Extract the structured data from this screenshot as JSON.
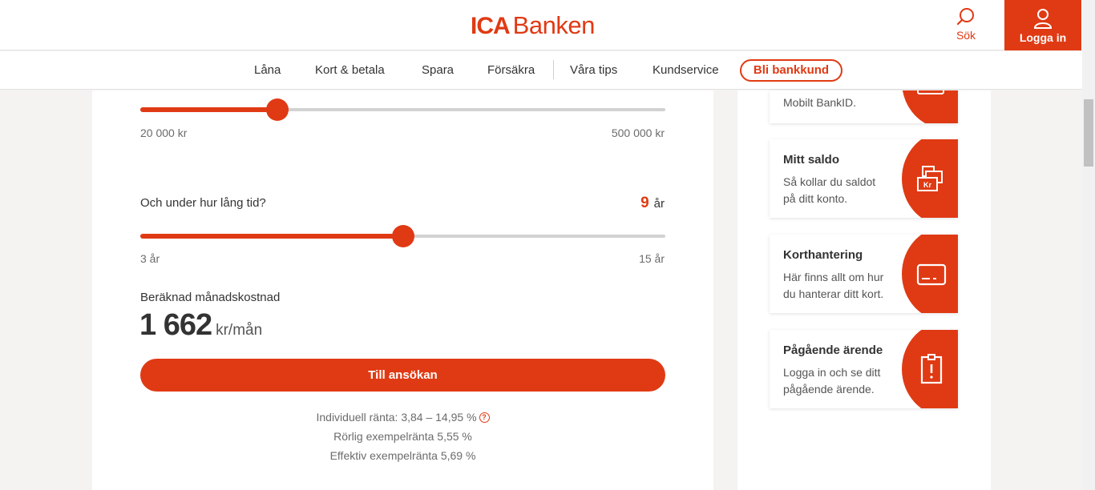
{
  "header": {
    "logo_ica": "ICA",
    "logo_banken": "Banken",
    "search_label": "Sök",
    "login_label": "Logga in"
  },
  "nav": {
    "items": [
      "Låna",
      "Kort & betala",
      "Spara",
      "Försäkra",
      "Våra tips",
      "Kundservice"
    ],
    "cta": "Bli bankkund"
  },
  "calculator": {
    "amount_slider": {
      "min_label": "20 000 kr",
      "max_label": "500 000 kr",
      "min": 20000,
      "max": 500000,
      "value": 145000
    },
    "term_question": "Och under hur lång tid?",
    "term_value": "9",
    "term_unit": "år",
    "term_slider": {
      "min_label": "3 år",
      "max_label": "15 år",
      "min": 3,
      "max": 15,
      "value": 9
    },
    "cost_label": "Beräknad månadskostnad",
    "cost_value": "1 662",
    "cost_unit": "kr/mån",
    "apply_label": "Till ansökan",
    "rate_individual": "Individuell ränta: 3,84 – 14,95 %",
    "rate_variable": "Rörlig exempelränta 5,55 %",
    "rate_effective": "Effektiv exempelränta 5,69 %",
    "info_glyph": "?"
  },
  "services": [
    {
      "title": "",
      "desc": "Mobilt BankID.",
      "icon": "partial-icon"
    },
    {
      "title": "Mitt saldo",
      "desc": "Så kollar du saldot på ditt konto.",
      "icon": "money-stack-icon",
      "icon_text": "Kr"
    },
    {
      "title": "Korthantering",
      "desc": "Här finns allt om hur du hanterar ditt kort.",
      "icon": "card-icon"
    },
    {
      "title": "Pågående ärende",
      "desc": "Logga in och se ditt pågående ärende.",
      "icon": "clipboard-alert-icon"
    }
  ],
  "colors": {
    "brand": "#e03a14",
    "track": "#d2d2d2"
  }
}
